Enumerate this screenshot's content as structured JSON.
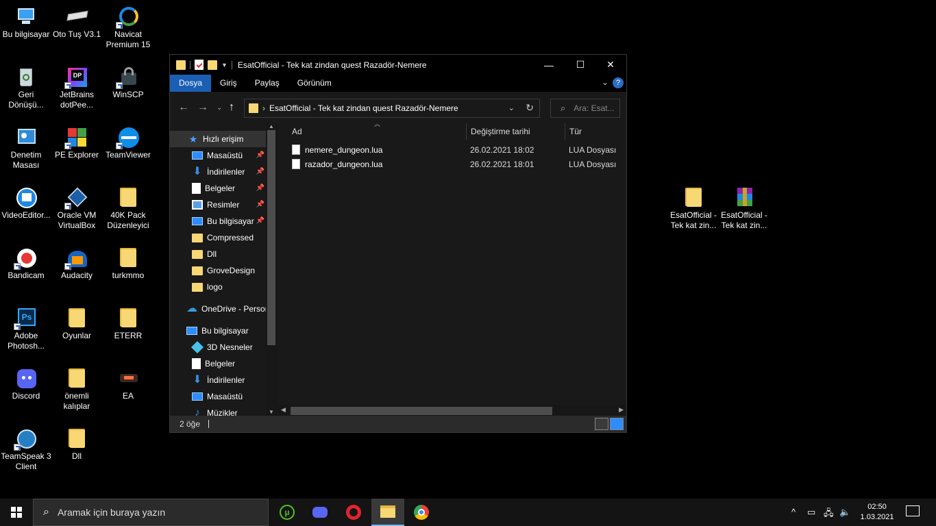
{
  "desktop": {
    "icons": [
      {
        "label": "Bu bilgisayar"
      },
      {
        "label": "Oto Tuş V3.1"
      },
      {
        "label": "Navicat Premium 15"
      },
      {
        "label": "Geri Dönüşü..."
      },
      {
        "label": "JetBrains dotPee..."
      },
      {
        "label": "WinSCP"
      },
      {
        "label": "Denetim Masası"
      },
      {
        "label": "PE Explorer"
      },
      {
        "label": "TeamViewer"
      },
      {
        "label": "VideoEditor..."
      },
      {
        "label": "Oracle VM VirtualBox"
      },
      {
        "label": "40K Pack Düzenleyici"
      },
      {
        "label": "Bandicam"
      },
      {
        "label": "Audacity"
      },
      {
        "label": "turkmmo"
      },
      {
        "label": "Adobe Photosh..."
      },
      {
        "label": "Oyunlar"
      },
      {
        "label": "ETERR"
      },
      {
        "label": "Discord"
      },
      {
        "label": "önemli kalıplar"
      },
      {
        "label": "EA"
      },
      {
        "label": "TeamSpeak 3 Client"
      },
      {
        "label": "Dll"
      },
      {
        "label": "EsatOfficial - Tek kat zin..."
      },
      {
        "label": "EsatOfficial - Tek kat zin..."
      }
    ]
  },
  "window": {
    "title": "EsatOfficial - Tek kat zindan quest Razadör-Nemere",
    "ribbon_tabs": [
      "Dosya",
      "Giriş",
      "Paylaş",
      "Görünüm"
    ],
    "address": "EsatOfficial - Tek kat zindan quest Razadör-Nemere",
    "search_placeholder": "Ara: Esat...",
    "nav": {
      "items": [
        "Hızlı erişim",
        "Masaüstü",
        "İndirilenler",
        "Belgeler",
        "Resimler",
        "Bu bilgisayar",
        "Compressed",
        "Dll",
        "GroveDesign",
        "logo",
        "OneDrive - Persor",
        "Bu bilgisayar",
        "3D Nesneler",
        "Belgeler",
        "İndirilenler",
        "Masaüstü",
        "Müzikler"
      ]
    },
    "columns": {
      "name": "Ad",
      "date": "Değiştirme tarihi",
      "type": "Tür"
    },
    "files": [
      {
        "name": "nemere_dungeon.lua",
        "date": "26.02.2021 18:02",
        "type": "LUA Dosyası"
      },
      {
        "name": "razador_dungeon.lua",
        "date": "26.02.2021 18:01",
        "type": "LUA Dosyası"
      }
    ],
    "status": "2 öğe"
  },
  "taskbar": {
    "search_placeholder": "Aramak için buraya yazın",
    "time": "02:50",
    "date": "1.03.2021"
  }
}
